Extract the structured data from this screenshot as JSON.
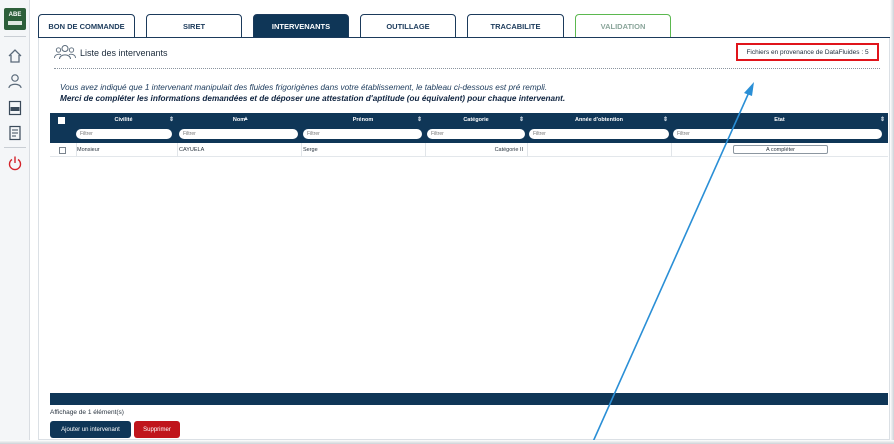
{
  "sidebar": {
    "logo_text": "ABE",
    "icons": [
      "home-icon",
      "user-icon",
      "sas-document-icon",
      "document-icon",
      "power-icon"
    ],
    "sas_label": "SAS"
  },
  "tabs": [
    {
      "label": "BON DE COMMANDE",
      "state": "normal"
    },
    {
      "label": "SIRET",
      "state": "normal"
    },
    {
      "label": "INTERVENANTS",
      "state": "active"
    },
    {
      "label": "OUTILLAGE",
      "state": "normal"
    },
    {
      "label": "TRACABILITE",
      "state": "normal"
    },
    {
      "label": "VALIDATION",
      "state": "validation"
    }
  ],
  "header": {
    "title": "Liste des intervenants",
    "datafluides": "Fichiers en provenance de DataFluides : 5"
  },
  "message": {
    "line1": "Vous avez indiqué que 1 intervenant manipulait des fluides frigorigènes dans votre établissement, le tableau ci-dessous est pré rempli.",
    "line2": "Merci de compléter les informations demandées et de déposer une attestation d'aptitude (ou équivalent) pour chaque intervenant."
  },
  "table": {
    "columns": [
      {
        "label": "Civilité",
        "sort": "⇕",
        "filter_placeholder": "Filtrer"
      },
      {
        "label": "Nom",
        "sort": "▲",
        "filter_placeholder": "Filtrer"
      },
      {
        "label": "Prénom",
        "sort": "⇕",
        "filter_placeholder": "Filtrer"
      },
      {
        "label": "Catégorie",
        "sort": "⇕",
        "filter_placeholder": "Filtrer"
      },
      {
        "label": "Année d'obtention",
        "sort": "⇕",
        "filter_placeholder": "Filtrer"
      },
      {
        "label": "Etat",
        "sort": "⇕",
        "filter_placeholder": "Filtrer"
      }
    ],
    "rows": [
      {
        "civilite": "Monsieur",
        "nom": "CAYUELA",
        "prenom": "Serge",
        "categorie": "Catégorie II",
        "annee": "",
        "etat": "A compléter"
      }
    ]
  },
  "footer": {
    "count": "Affichage de 1 élément(s)",
    "add_button": "Ajouter un intervenant",
    "delete_button": "Supprimer"
  },
  "colors": {
    "navy": "#0f3657",
    "highlight_red": "#e0141b",
    "delete_red": "#c0151c",
    "validation_green": "#5bb84f",
    "arrow_blue": "#2a8fd6"
  }
}
